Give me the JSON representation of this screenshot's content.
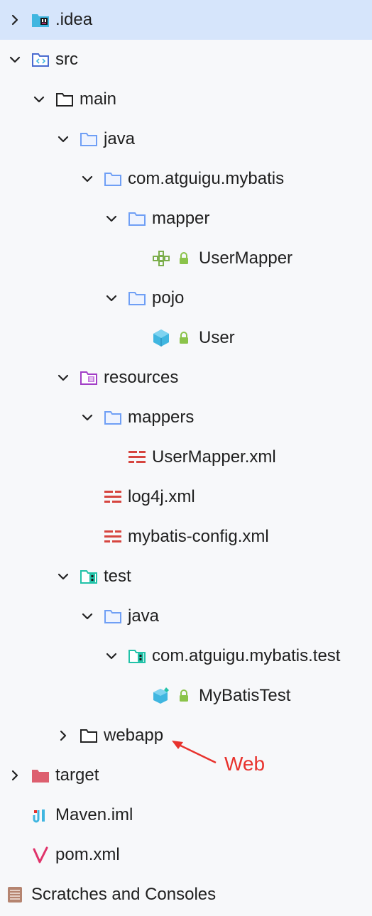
{
  "tree": {
    "idea": {
      "label": ".idea"
    },
    "src": {
      "label": "src"
    },
    "main": {
      "label": "main"
    },
    "java": {
      "label": "java"
    },
    "package": {
      "label": "com.atguigu.mybatis"
    },
    "mapper": {
      "label": "mapper"
    },
    "usermapper": {
      "label": "UserMapper"
    },
    "pojo": {
      "label": "pojo"
    },
    "user": {
      "label": "User"
    },
    "resources": {
      "label": "resources"
    },
    "mappers": {
      "label": "mappers"
    },
    "usermapper_xml": {
      "label": "UserMapper.xml"
    },
    "log4j": {
      "label": "log4j.xml"
    },
    "mybatis_config": {
      "label": "mybatis-config.xml"
    },
    "test": {
      "label": "test"
    },
    "test_java": {
      "label": "java"
    },
    "test_package": {
      "label": "com.atguigu.mybatis.test"
    },
    "mybatistest": {
      "label": "MyBatisTest"
    },
    "webapp": {
      "label": "webapp"
    },
    "target": {
      "label": "target"
    },
    "maven_iml": {
      "label": "Maven.iml"
    },
    "pom": {
      "label": "pom.xml"
    },
    "scratches": {
      "label": "Scratches and Consoles"
    }
  },
  "annotation": {
    "text": "Web"
  },
  "colors": {
    "selected_bg": "#d6e5fb",
    "background": "#f7f8fa",
    "folder_blue": "#6f9ff5",
    "source_blue": "#4a6bd0",
    "resources_purple": "#a23fc6",
    "test_teal": "#22c2a8",
    "target_red": "#dd5f6f",
    "xml_red": "#d6453f",
    "class_cyan": "#40b6e0",
    "interface_green": "#7cae4c",
    "lock_green": "#8bc34a",
    "annotation_red": "#e8322d"
  }
}
